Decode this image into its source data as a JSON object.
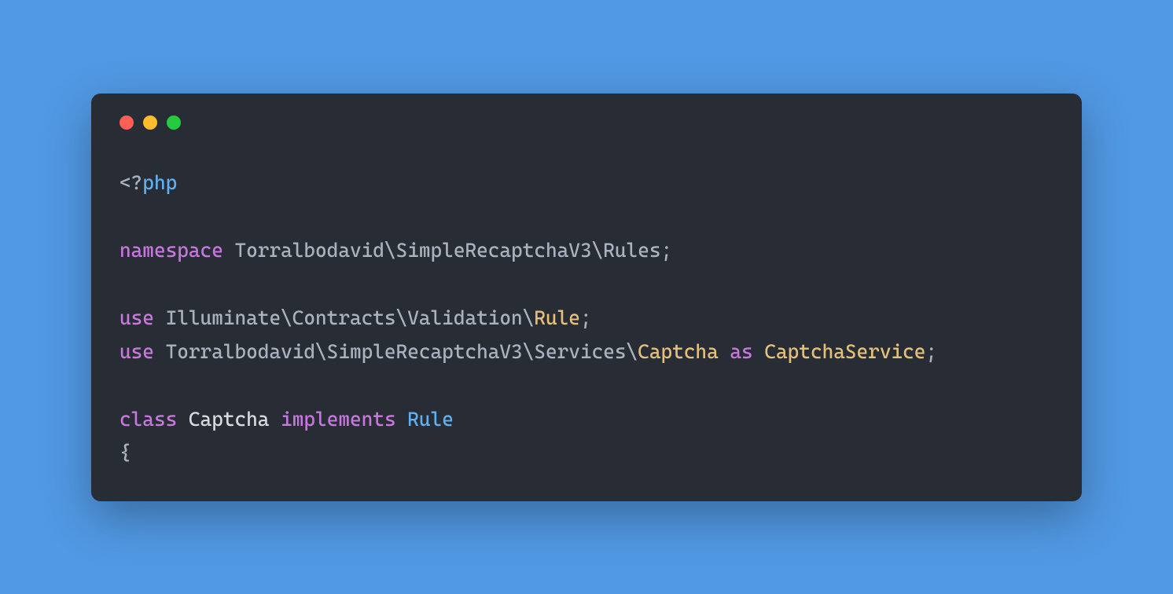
{
  "code": {
    "open_tag_lt": "<?",
    "open_tag_php": "php",
    "namespace_kw": "namespace",
    "namespace_path": " Torralbodavid\\SimpleRecaptchaV3\\Rules",
    "semicolon": ";",
    "use_kw": "use",
    "use1_path": " Illuminate\\Contracts\\Validation\\",
    "use1_class": "Rule",
    "use2_path": " Torralbodavid\\SimpleRecaptchaV3\\Services\\",
    "use2_class": "Captcha",
    "as_kw": "as",
    "use2_alias": "CaptchaService",
    "class_kw": "class",
    "class_name": "Captcha",
    "implements_kw": "implements",
    "implements_type": "Rule",
    "brace_open": "{"
  },
  "window": {
    "traffic_red": "close",
    "traffic_yellow": "minimize",
    "traffic_green": "zoom"
  }
}
